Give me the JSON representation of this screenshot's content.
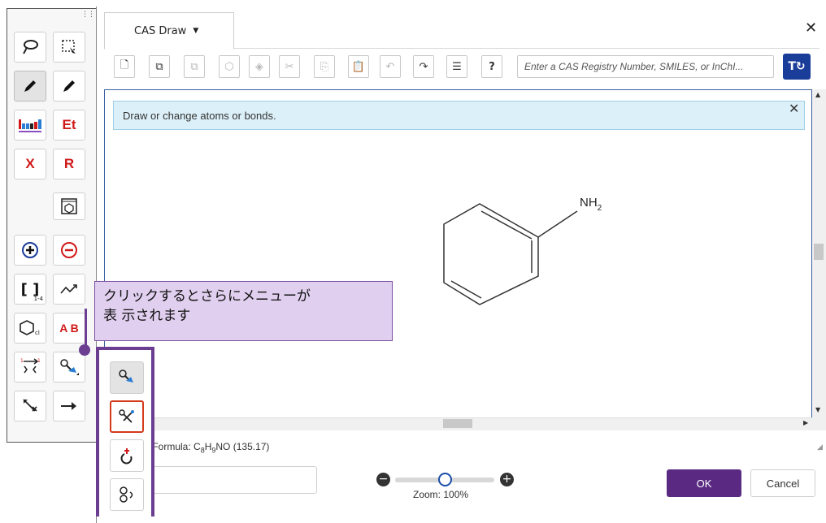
{
  "dialog": {
    "tab_label": "CAS Draw",
    "search_placeholder": "Enter a CAS Registry Number, SMILES, or InChI..."
  },
  "info_bar": {
    "message": "Draw or change atoms or bonds."
  },
  "palette": {
    "et_label": "Et",
    "x_label": "X",
    "r_label": "R",
    "bracket_subscript": "1-4",
    "ab_label": "A B"
  },
  "molecule": {
    "substituent": "NH",
    "substituent_subscript": "2"
  },
  "footer": {
    "formula_prefix": "r Formula: C",
    "formula_c": "8",
    "formula_h_prefix": "H",
    "formula_h": "9",
    "formula_suffix": "NO (135.17)",
    "zoom_label": "Zoom: 100%",
    "zoom_value": 0.5,
    "ok_label": "OK",
    "cancel_label": "Cancel"
  },
  "callout": {
    "line1": "クリックするとさらにメニューが",
    "line2": "表 示されます"
  },
  "colors": {
    "accent_purple": "#6b3e91",
    "ok_button": "#5a2a83",
    "info_bg": "#dcf0f9",
    "toggle_blue": "#1a3d99",
    "highlight_red": "#d43a1a"
  }
}
